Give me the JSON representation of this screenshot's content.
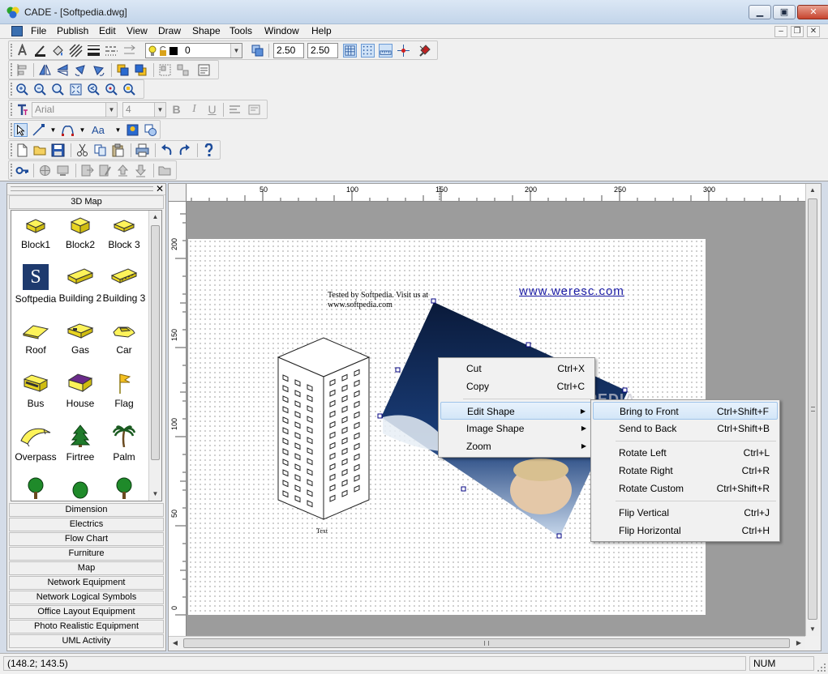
{
  "window": {
    "title": "CADE - [Softpedia.dwg]"
  },
  "menu": {
    "items": [
      "File",
      "Publish",
      "Edit",
      "View",
      "Draw",
      "Shape",
      "Tools",
      "Window",
      "Help"
    ]
  },
  "toolbar": {
    "layer_value": "0",
    "line_width_1": "2.50",
    "line_width_2": "2.50",
    "font_name": "Arial",
    "font_size": "4",
    "text_style_label": "Aa"
  },
  "left_panel": {
    "active_category": "3D Map",
    "shapes": [
      {
        "label": "Block1"
      },
      {
        "label": "Block2"
      },
      {
        "label": "Block 3"
      },
      {
        "label": "Softpedia"
      },
      {
        "label": "Building 2"
      },
      {
        "label": "Building 3"
      },
      {
        "label": "Roof"
      },
      {
        "label": "Gas"
      },
      {
        "label": "Car"
      },
      {
        "label": "Bus"
      },
      {
        "label": "House"
      },
      {
        "label": "Flag"
      },
      {
        "label": "Overpass"
      },
      {
        "label": "Firtree"
      },
      {
        "label": "Palm"
      }
    ],
    "logo_letter": "S",
    "categories": [
      "Dimension",
      "Electrics",
      "Flow Chart",
      "Furniture",
      "Map",
      "Network Equipment",
      "Network Logical Symbols",
      "Office Layout Equipment",
      "Photo Realistic Equipment",
      "UML Activity"
    ]
  },
  "rulers": {
    "top": [
      "50",
      "100",
      "150",
      "200",
      "250",
      "300"
    ],
    "left": [
      "200",
      "150",
      "100",
      "50",
      "0"
    ]
  },
  "canvas": {
    "note_line1": "Tested by Softpedia. Visit us at",
    "note_line2": "www.softpedia.com",
    "link_text": "www.weresc.com",
    "building_label": "Text",
    "watermark": "SOFTPEDIA"
  },
  "context_menu": {
    "items": [
      {
        "label": "Cut",
        "shortcut": "Ctrl+X"
      },
      {
        "label": "Copy",
        "shortcut": "Ctrl+C"
      },
      {
        "label": "Edit Shape",
        "submenu": true
      },
      {
        "label": "Image Shape",
        "submenu": true
      },
      {
        "label": "Zoom",
        "submenu": true
      }
    ]
  },
  "submenu": {
    "items": [
      {
        "label": "Bring to Front",
        "shortcut": "Ctrl+Shift+F"
      },
      {
        "label": "Send to Back",
        "shortcut": "Ctrl+Shift+B"
      },
      {
        "label": "Rotate Left",
        "shortcut": "Ctrl+L"
      },
      {
        "label": "Rotate Right",
        "shortcut": "Ctrl+R"
      },
      {
        "label": "Rotate Custom",
        "shortcut": "Ctrl+Shift+R"
      },
      {
        "label": "Flip Vertical",
        "shortcut": "Ctrl+J"
      },
      {
        "label": "Flip Horizontal",
        "shortcut": "Ctrl+H"
      }
    ]
  },
  "status": {
    "coords": "(148.2; 143.5)",
    "num": "NUM"
  },
  "colors": {
    "selection": "#000080",
    "highlight": "#d3e6f8",
    "link": "#1a1aa6",
    "icon_yellow": "#f4e233"
  }
}
